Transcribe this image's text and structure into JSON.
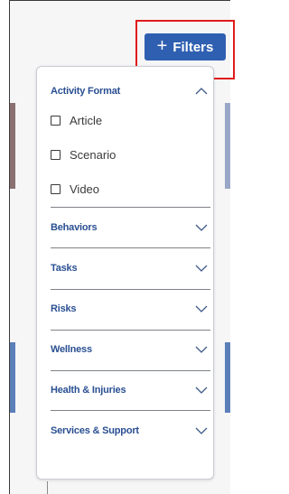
{
  "colors": {
    "accent": "#2f5fb1",
    "section_title": "#2a4f92",
    "highlight": "#e01b1b"
  },
  "filters_button": {
    "icon": "plus-icon",
    "label": "Filters"
  },
  "panel": {
    "sections": [
      {
        "title": "Activity Format",
        "expanded": true,
        "icon": "chevron-up-icon",
        "options": [
          {
            "label": "Article",
            "checked": false
          },
          {
            "label": "Scenario",
            "checked": false
          },
          {
            "label": "Video",
            "checked": false
          }
        ]
      },
      {
        "title": "Behaviors",
        "expanded": false,
        "icon": "chevron-down-icon"
      },
      {
        "title": "Tasks",
        "expanded": false,
        "icon": "chevron-down-icon"
      },
      {
        "title": "Risks",
        "expanded": false,
        "icon": "chevron-down-icon"
      },
      {
        "title": "Wellness",
        "expanded": false,
        "icon": "chevron-down-icon"
      },
      {
        "title": "Health & Injuries",
        "expanded": false,
        "icon": "chevron-down-icon"
      },
      {
        "title": "Services & Support",
        "expanded": false,
        "icon": "chevron-down-icon"
      }
    ]
  }
}
